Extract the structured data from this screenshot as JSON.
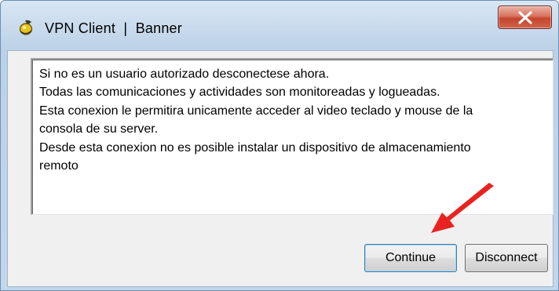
{
  "window": {
    "title": "VPN Client  |  Banner",
    "app_icon": "vpn-client-icon",
    "close_icon": "close-icon",
    "close_button_color": "#c5452d"
  },
  "banner": {
    "lines": [
      "Si no es un usuario autorizado desconectese ahora.",
      "Todas las comunicaciones y actividades son monitoreadas y logueadas.",
      "Esta conexion le permitira unicamente acceder al video teclado y mouse de la",
      "consola de su server.",
      "Desde esta conexion no es posible instalar un dispositivo de almacenamiento",
      "remoto"
    ]
  },
  "buttons": {
    "continue_label": "Continue",
    "disconnect_label": "Disconnect"
  },
  "annotation": {
    "arrow_color": "#e8231f",
    "arrow_icon": "red-arrow-icon"
  }
}
